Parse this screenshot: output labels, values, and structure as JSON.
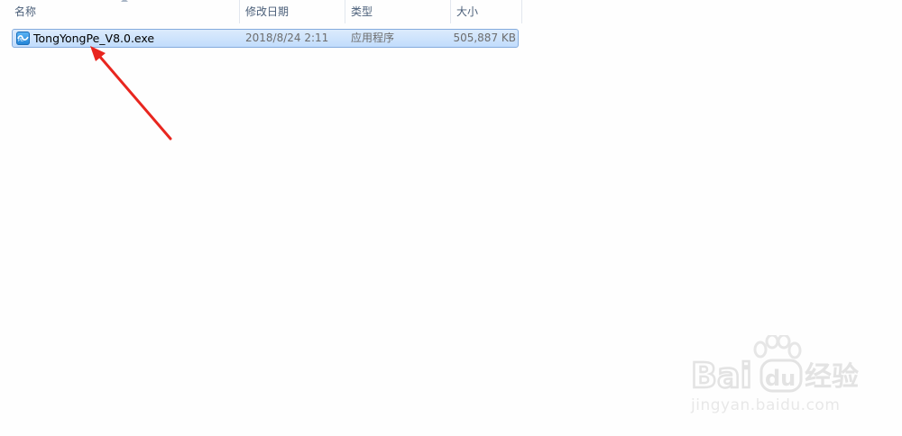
{
  "columns": {
    "name": "名称",
    "modified": "修改日期",
    "type": "类型",
    "size": "大小"
  },
  "files": [
    {
      "name": "TongYongPe_V8.0.exe",
      "modified": "2018/8/24 2:11",
      "type": "应用程序",
      "size": "505,887 KB",
      "icon": "app-exe-icon",
      "selected": true
    }
  ],
  "annotation": {
    "color": "#e8261f",
    "icon": "red-arrow"
  },
  "watermark": {
    "logo": "Baidu经验",
    "url": "jingyan.baidu.com"
  },
  "colors": {
    "selection_fill": "#cfe4fc",
    "selection_border": "#84acdd",
    "header_text": "#4c607a"
  }
}
